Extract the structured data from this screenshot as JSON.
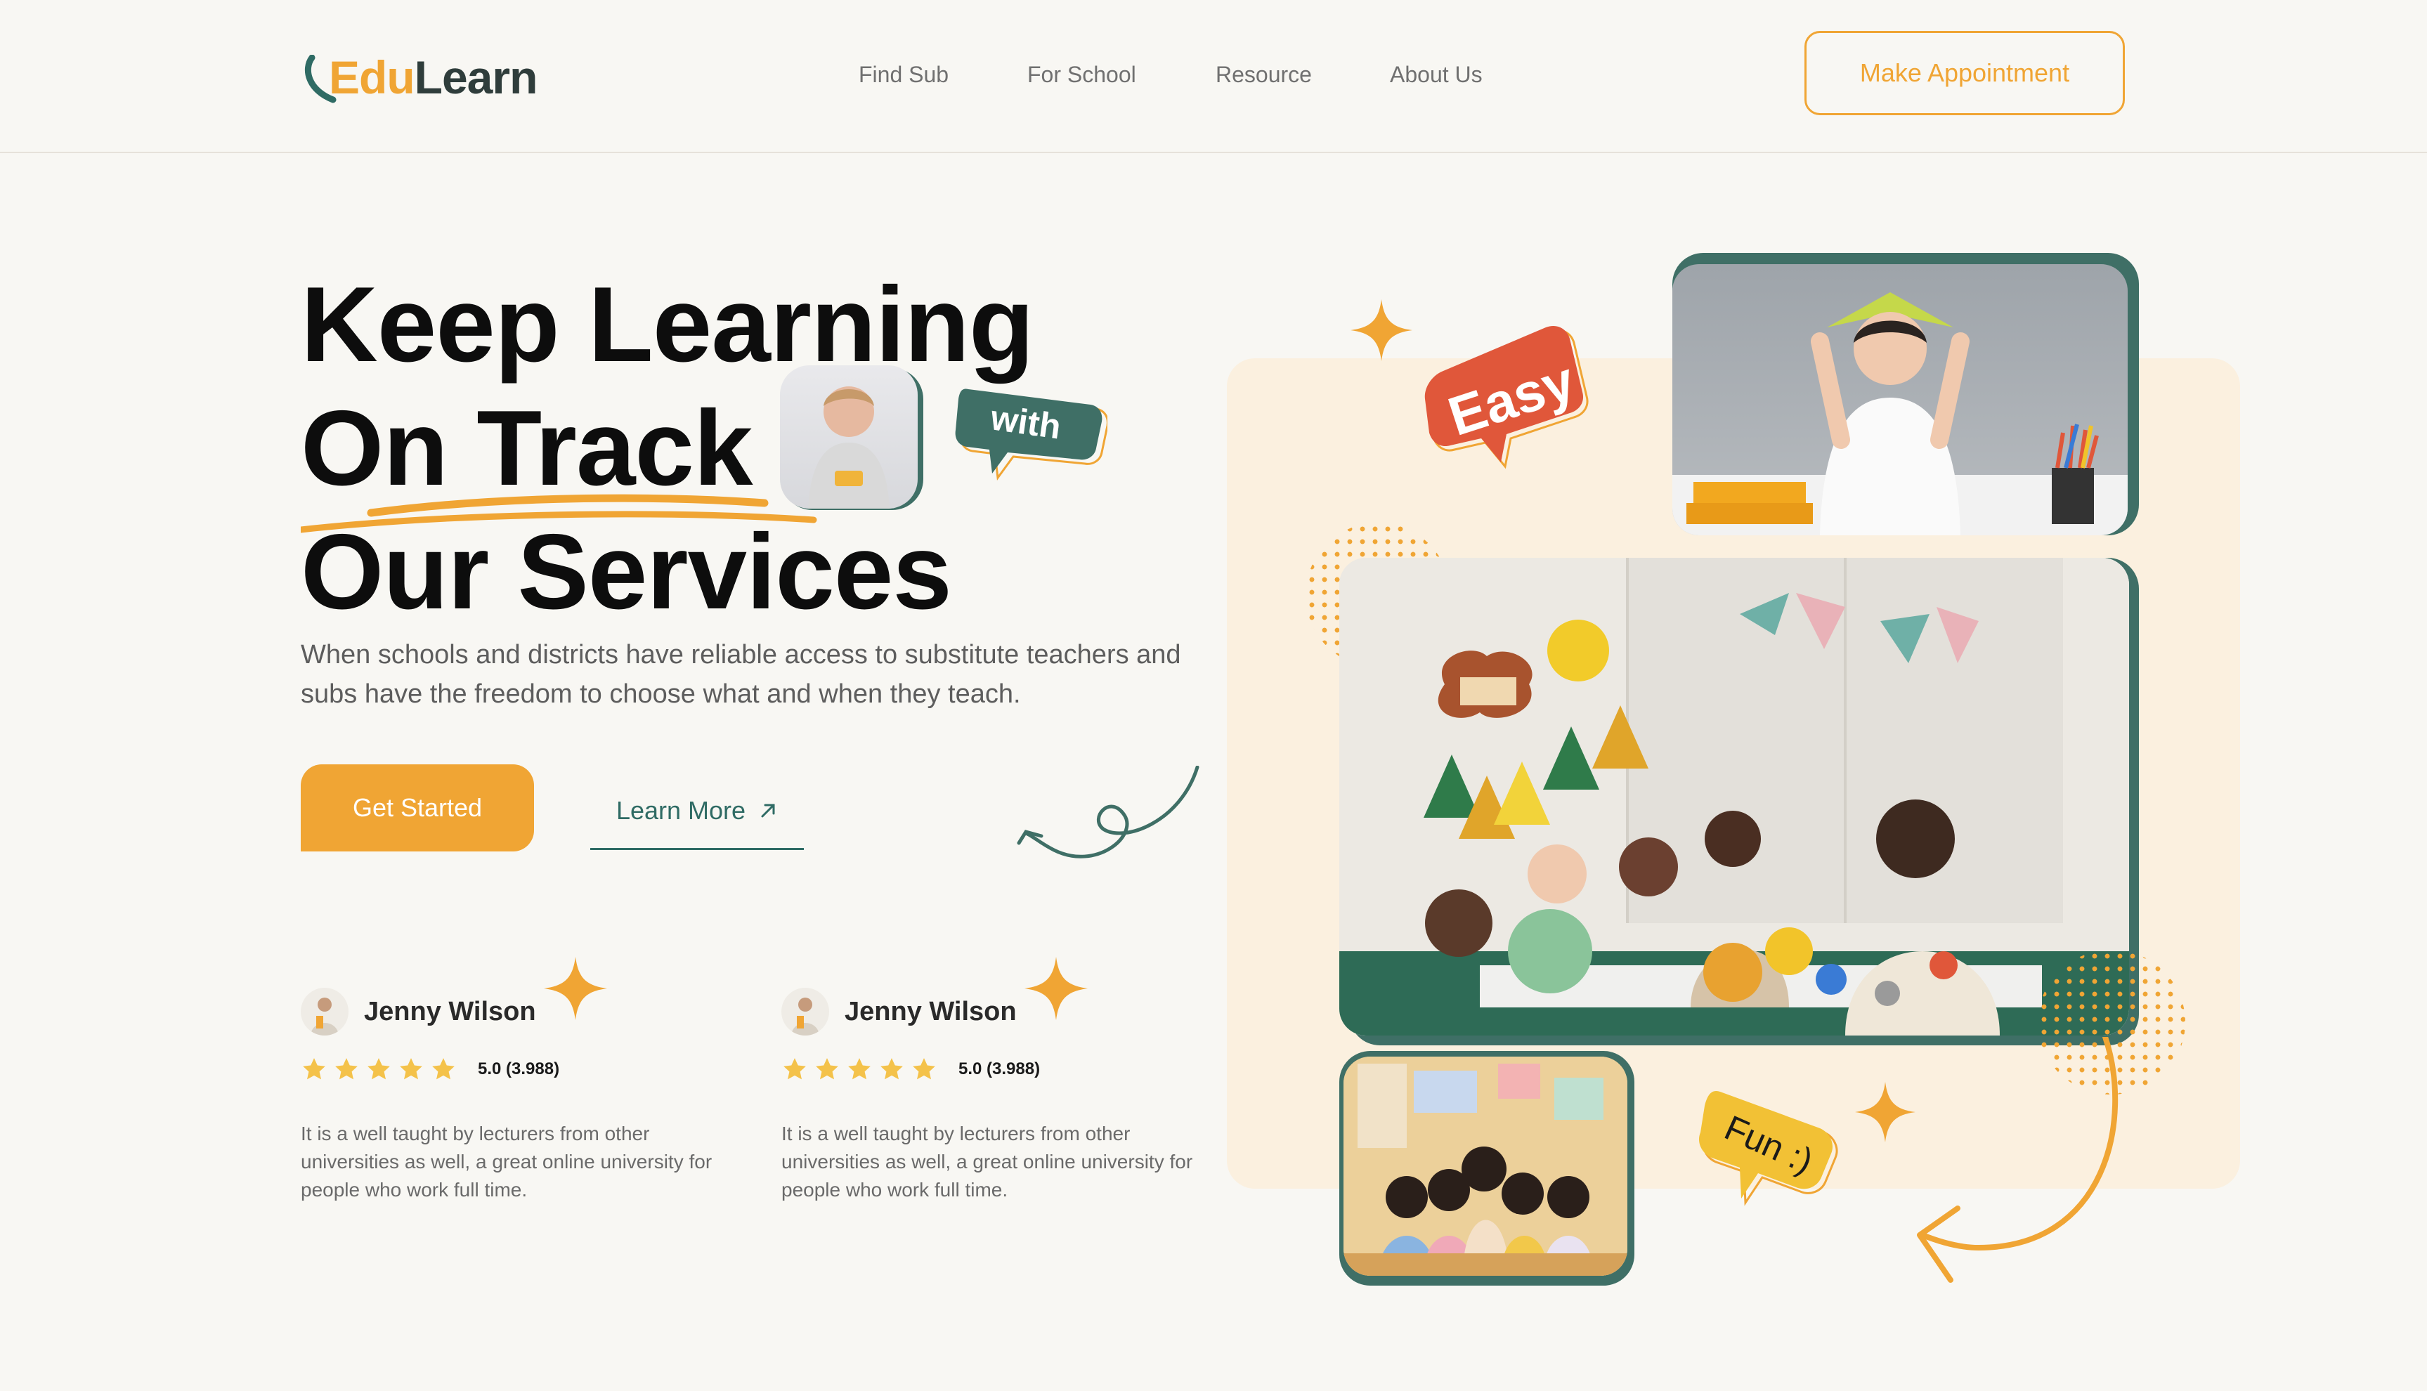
{
  "brand": {
    "edu": "Edu",
    "learn": "Learn"
  },
  "nav": {
    "items": [
      "Find Sub",
      "For School",
      "Resource",
      "About Us"
    ],
    "appointment_label": "Make Appointment"
  },
  "hero": {
    "line1": "Keep Learning",
    "line2": "On Track",
    "line3": "Our Services",
    "with_badge": "with",
    "subtitle": "When schools and districts have reliable access to substitute teachers and subs have the freedom to choose what and when they teach.",
    "primary_cta": "Get Started",
    "secondary_cta": "Learn More"
  },
  "reviews": [
    {
      "name": "Jenny Wilson",
      "rating": "5.0 (3.988)",
      "stars": 5,
      "text": "It is a well taught by lecturers from other universities as well, a great online university for people who work full time."
    },
    {
      "name": "Jenny Wilson",
      "rating": "5.0 (3.988)",
      "stars": 5,
      "text": "It is a well taught by lecturers from other universities as well, a great online university for people who work full time."
    }
  ],
  "badges": {
    "easy": "Easy",
    "fun": "Fun :)"
  },
  "colors": {
    "accent": "#f0a534",
    "teal": "#3f6f66",
    "bubble_red": "#e0573a",
    "cream": "#fbf0df"
  }
}
